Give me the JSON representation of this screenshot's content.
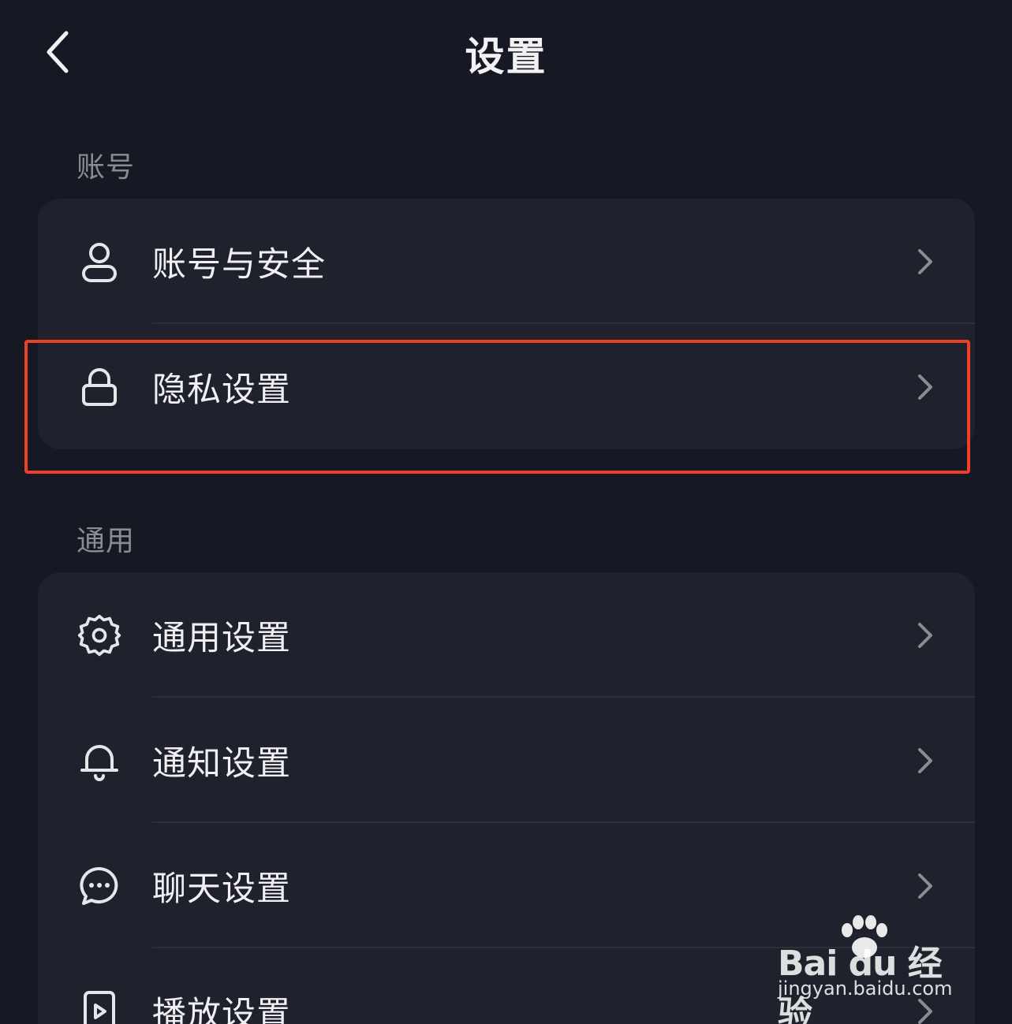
{
  "header": {
    "title": "设置",
    "back_icon": "chevron-left-icon"
  },
  "sections": [
    {
      "label": "账号",
      "items": [
        {
          "label": "账号与安全",
          "icon": "user-icon"
        },
        {
          "label": "隐私设置",
          "icon": "lock-icon",
          "highlighted": true
        }
      ]
    },
    {
      "label": "通用",
      "items": [
        {
          "label": "通用设置",
          "icon": "gear-icon"
        },
        {
          "label": "通知设置",
          "icon": "bell-icon"
        },
        {
          "label": "聊天设置",
          "icon": "chat-bubble-icon"
        },
        {
          "label": "播放设置",
          "icon": "play-file-icon"
        }
      ]
    }
  ],
  "watermark": {
    "logo_text": "Bai du 经验",
    "url": "jingyan.baidu.com"
  },
  "colors": {
    "background": "#161823",
    "card": "#1f212c",
    "highlight": "#ee3f29"
  }
}
